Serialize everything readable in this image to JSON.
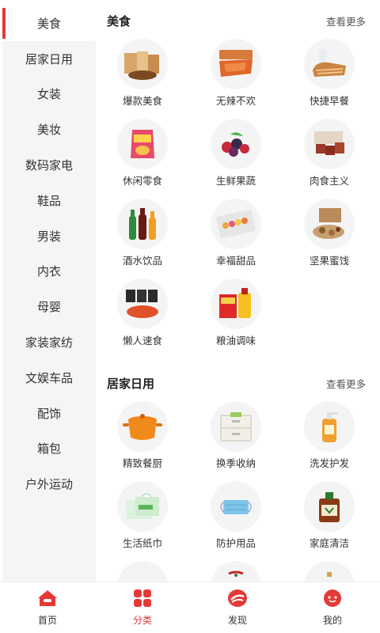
{
  "sidebar": {
    "items": [
      {
        "label": "美食",
        "active": true
      },
      {
        "label": "居家日用"
      },
      {
        "label": "女装"
      },
      {
        "label": "美妆"
      },
      {
        "label": "数码家电"
      },
      {
        "label": "鞋品"
      },
      {
        "label": "男装"
      },
      {
        "label": "内衣"
      },
      {
        "label": "母婴"
      },
      {
        "label": "家装家纺"
      },
      {
        "label": "文娱车品"
      },
      {
        "label": "配饰"
      },
      {
        "label": "箱包"
      },
      {
        "label": "户外运动"
      }
    ]
  },
  "sections": [
    {
      "title": "美食",
      "more": "查看更多",
      "items": [
        {
          "label": "爆款美食",
          "icon": "snack-box-icon"
        },
        {
          "label": "无辣不欢",
          "icon": "spicy-jerky-icon"
        },
        {
          "label": "快捷早餐",
          "icon": "bread-icon"
        },
        {
          "label": "休闲零食",
          "icon": "chips-bag-icon"
        },
        {
          "label": "生鲜果蔬",
          "icon": "berries-icon"
        },
        {
          "label": "肉食主义",
          "icon": "meat-icon"
        },
        {
          "label": "酒水饮品",
          "icon": "bottles-icon"
        },
        {
          "label": "幸福甜品",
          "icon": "macaron-icon"
        },
        {
          "label": "坚果蜜饯",
          "icon": "nuts-icon"
        },
        {
          "label": "懒人速食",
          "icon": "instant-noodle-icon"
        },
        {
          "label": "粮油调味",
          "icon": "oil-rice-icon"
        }
      ]
    },
    {
      "title": "居家日用",
      "more": "查看更多",
      "items": [
        {
          "label": "精致餐厨",
          "icon": "pot-icon"
        },
        {
          "label": "换季收纳",
          "icon": "storage-box-icon"
        },
        {
          "label": "洗发护发",
          "icon": "shampoo-icon"
        },
        {
          "label": "生活纸巾",
          "icon": "tissue-icon"
        },
        {
          "label": "防护用品",
          "icon": "mask-icon"
        },
        {
          "label": "家庭清洁",
          "icon": "disinfectant-icon"
        },
        {
          "label": "",
          "icon": "more-item-icon"
        },
        {
          "label": "",
          "icon": "more-item-icon"
        },
        {
          "label": "",
          "icon": "more-item-icon"
        }
      ]
    }
  ],
  "tabbar": {
    "tabs": [
      {
        "label": "首页",
        "icon": "home-icon"
      },
      {
        "label": "分类",
        "icon": "category-icon",
        "active": true
      },
      {
        "label": "发现",
        "icon": "discover-icon"
      },
      {
        "label": "我的",
        "icon": "profile-icon"
      }
    ]
  },
  "colors": {
    "accent": "#e53935",
    "sidebar_bg": "#f5f5f5"
  }
}
